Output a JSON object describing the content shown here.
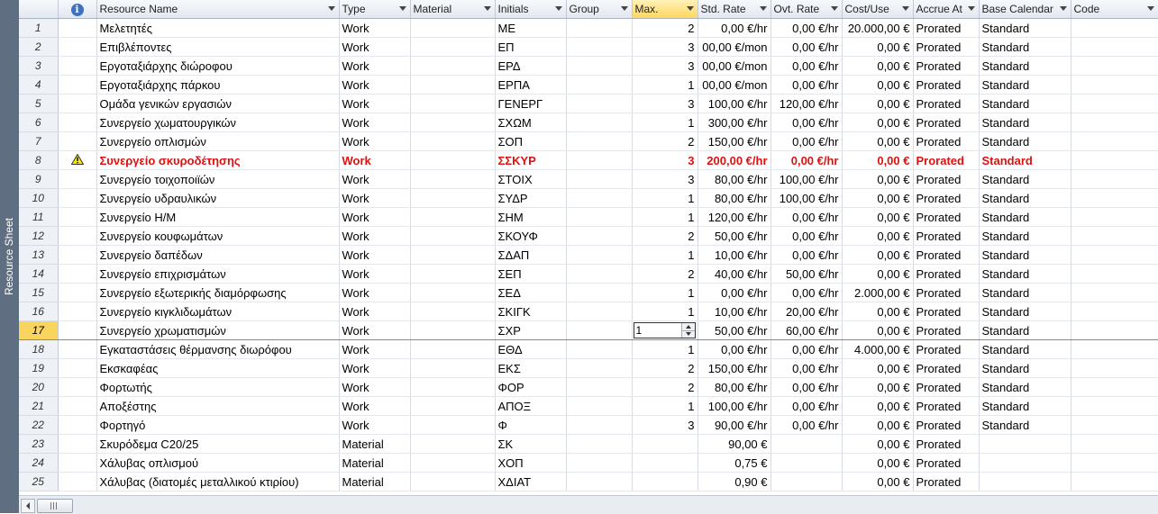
{
  "view": {
    "side_label": "Resource Sheet"
  },
  "columns": {
    "info": "i",
    "name": "Resource Name",
    "type": "Type",
    "material": "Material",
    "initials": "Initials",
    "group": "Group",
    "max": "Max.",
    "std_rate": "Std. Rate",
    "ovt_rate": "Ovt. Rate",
    "cost_use": "Cost/Use",
    "accrue": "Accrue At",
    "calendar": "Base Calendar",
    "code": "Code"
  },
  "editor": {
    "max_value": "1"
  },
  "rows": [
    {
      "id": "1",
      "name": "Μελετητές",
      "type": "Work",
      "initials": "ΜΕ",
      "max": "2",
      "std": "0,00 €/hr",
      "ovt": "0,00 €/hr",
      "cost": "20.000,00 €",
      "accrue": "Prorated",
      "cal": "Standard"
    },
    {
      "id": "2",
      "name": "Επιβλέποντες",
      "type": "Work",
      "initials": "ΕΠ",
      "max": "3",
      "std": "00,00 €/mon",
      "ovt": "0,00 €/hr",
      "cost": "0,00 €",
      "accrue": "Prorated",
      "cal": "Standard"
    },
    {
      "id": "3",
      "name": "Εργοταξιάρχης διώροφου",
      "type": "Work",
      "initials": "ΕΡΔ",
      "max": "3",
      "std": "00,00 €/mon",
      "ovt": "0,00 €/hr",
      "cost": "0,00 €",
      "accrue": "Prorated",
      "cal": "Standard"
    },
    {
      "id": "4",
      "name": "Εργοταξιάρχης πάρκου",
      "type": "Work",
      "initials": "ΕΡΠΑ",
      "max": "1",
      "std": "00,00 €/mon",
      "ovt": "0,00 €/hr",
      "cost": "0,00 €",
      "accrue": "Prorated",
      "cal": "Standard"
    },
    {
      "id": "5",
      "name": "Ομάδα γενικών εργασιών",
      "type": "Work",
      "initials": "ΓΕΝΕΡΓ",
      "max": "3",
      "std": "100,00 €/hr",
      "ovt": "120,00 €/hr",
      "cost": "0,00 €",
      "accrue": "Prorated",
      "cal": "Standard"
    },
    {
      "id": "6",
      "name": "Συνεργείο χωματουργικών",
      "type": "Work",
      "initials": "ΣΧΩΜ",
      "max": "1",
      "std": "300,00 €/hr",
      "ovt": "0,00 €/hr",
      "cost": "0,00 €",
      "accrue": "Prorated",
      "cal": "Standard"
    },
    {
      "id": "7",
      "name": "Συνεργείο οπλισμών",
      "type": "Work",
      "initials": "ΣΟΠ",
      "max": "2",
      "std": "150,00 €/hr",
      "ovt": "0,00 €/hr",
      "cost": "0,00 €",
      "accrue": "Prorated",
      "cal": "Standard"
    },
    {
      "id": "8",
      "name": "Συνεργείο σκυροδέτησης",
      "type": "Work",
      "initials": "ΣΣΚΥΡ",
      "max": "3",
      "std": "200,00 €/hr",
      "ovt": "0,00 €/hr",
      "cost": "0,00 €",
      "accrue": "Prorated",
      "cal": "Standard"
    },
    {
      "id": "9",
      "name": "Συνεργείο τοιχοποιϊών",
      "type": "Work",
      "initials": "ΣΤΟΙΧ",
      "max": "3",
      "std": "80,00 €/hr",
      "ovt": "100,00 €/hr",
      "cost": "0,00 €",
      "accrue": "Prorated",
      "cal": "Standard"
    },
    {
      "id": "10",
      "name": "Συνεργείο υδραυλικών",
      "type": "Work",
      "initials": "ΣΥΔΡ",
      "max": "1",
      "std": "80,00 €/hr",
      "ovt": "100,00 €/hr",
      "cost": "0,00 €",
      "accrue": "Prorated",
      "cal": "Standard"
    },
    {
      "id": "11",
      "name": "Συνεργείο Η/Μ",
      "type": "Work",
      "initials": "ΣΗΜ",
      "max": "1",
      "std": "120,00 €/hr",
      "ovt": "0,00 €/hr",
      "cost": "0,00 €",
      "accrue": "Prorated",
      "cal": "Standard"
    },
    {
      "id": "12",
      "name": "Συνεργείο κουφωμάτων",
      "type": "Work",
      "initials": "ΣΚΟΥΦ",
      "max": "2",
      "std": "50,00 €/hr",
      "ovt": "0,00 €/hr",
      "cost": "0,00 €",
      "accrue": "Prorated",
      "cal": "Standard"
    },
    {
      "id": "13",
      "name": "Συνεργείο δαπέδων",
      "type": "Work",
      "initials": "ΣΔΑΠ",
      "max": "1",
      "std": "10,00 €/hr",
      "ovt": "0,00 €/hr",
      "cost": "0,00 €",
      "accrue": "Prorated",
      "cal": "Standard"
    },
    {
      "id": "14",
      "name": "Συνεργείο επιχρισμάτων",
      "type": "Work",
      "initials": "ΣΕΠ",
      "max": "2",
      "std": "40,00 €/hr",
      "ovt": "50,00 €/hr",
      "cost": "0,00 €",
      "accrue": "Prorated",
      "cal": "Standard"
    },
    {
      "id": "15",
      "name": "Συνεργείο εξωτερικής διαμόρφωσης",
      "type": "Work",
      "initials": "ΣΕΔ",
      "max": "1",
      "std": "0,00 €/hr",
      "ovt": "0,00 €/hr",
      "cost": "2.000,00 €",
      "accrue": "Prorated",
      "cal": "Standard"
    },
    {
      "id": "16",
      "name": "Συνεργείο κιγκλιδωμάτων",
      "type": "Work",
      "initials": "ΣΚΙΓΚ",
      "max": "1",
      "std": "10,00 €/hr",
      "ovt": "20,00 €/hr",
      "cost": "0,00 €",
      "accrue": "Prorated",
      "cal": "Standard"
    },
    {
      "id": "17",
      "name": "Συνεργείο χρωματισμών",
      "type": "Work",
      "initials": "ΣΧΡ",
      "max": "1",
      "std": "50,00 €/hr",
      "ovt": "60,00 €/hr",
      "cost": "0,00 €",
      "accrue": "Prorated",
      "cal": "Standard"
    },
    {
      "id": "18",
      "name": "Εγκαταστάσεις θέρμανσης διωρόφου",
      "type": "Work",
      "initials": "ΕΘΔ",
      "max": "1",
      "std": "0,00 €/hr",
      "ovt": "0,00 €/hr",
      "cost": "4.000,00 €",
      "accrue": "Prorated",
      "cal": "Standard"
    },
    {
      "id": "19",
      "name": "Εκσκαφέας",
      "type": "Work",
      "initials": "ΕΚΣ",
      "max": "2",
      "std": "150,00 €/hr",
      "ovt": "0,00 €/hr",
      "cost": "0,00 €",
      "accrue": "Prorated",
      "cal": "Standard"
    },
    {
      "id": "20",
      "name": "Φορτωτής",
      "type": "Work",
      "initials": "ΦΟΡ",
      "max": "2",
      "std": "80,00 €/hr",
      "ovt": "0,00 €/hr",
      "cost": "0,00 €",
      "accrue": "Prorated",
      "cal": "Standard"
    },
    {
      "id": "21",
      "name": "Αποξέστης",
      "type": "Work",
      "initials": "ΑΠΟΞ",
      "max": "1",
      "std": "100,00 €/hr",
      "ovt": "0,00 €/hr",
      "cost": "0,00 €",
      "accrue": "Prorated",
      "cal": "Standard"
    },
    {
      "id": "22",
      "name": "Φορτηγό",
      "type": "Work",
      "initials": "Φ",
      "max": "3",
      "std": "90,00 €/hr",
      "ovt": "0,00 €/hr",
      "cost": "0,00 €",
      "accrue": "Prorated",
      "cal": "Standard"
    },
    {
      "id": "23",
      "name": "Σκυρόδεμα C20/25",
      "type": "Material",
      "initials": "ΣΚ",
      "max": "",
      "std": "90,00 €",
      "ovt": "",
      "cost": "0,00 €",
      "accrue": "Prorated",
      "cal": ""
    },
    {
      "id": "24",
      "name": "Χάλυβας οπλισμού",
      "type": "Material",
      "initials": "ΧΟΠ",
      "max": "",
      "std": "0,75 €",
      "ovt": "",
      "cost": "0,00 €",
      "accrue": "Prorated",
      "cal": ""
    },
    {
      "id": "25",
      "name": "Χάλυβας (διατομές μεταλλικού κτιρίου)",
      "type": "Material",
      "initials": "ΧΔΙΑΤ",
      "max": "",
      "std": "0,90 €",
      "ovt": "",
      "cost": "0,00 €",
      "accrue": "Prorated",
      "cal": ""
    }
  ],
  "overallocated_row": "8",
  "selected_row": "17",
  "colors": {
    "overallocated_text": "#e01010",
    "selected_row_header": "#f9d45f",
    "view_bar": "#5f6e80"
  }
}
